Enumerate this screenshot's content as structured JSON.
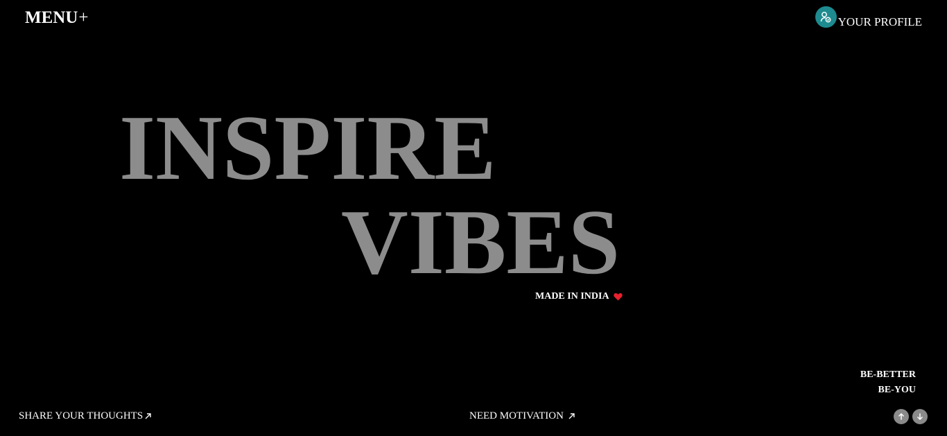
{
  "header": {
    "menu_label": "MENU",
    "menu_plus": "+",
    "profile_label": "YOUR PROFILE"
  },
  "hero": {
    "line1": "INSPIRE",
    "line2": "VIBES",
    "made_in": "MADE IN INDIA"
  },
  "taglines": [
    "BE-BETTER",
    "BE-YOU"
  ],
  "footer": {
    "share_label": "SHARE YOUR THOUGHTS",
    "motivation_label": "NEED MOTIVATION"
  },
  "icons": {
    "profile": "profile-icon",
    "heart": "heart-icon",
    "external": "arrow-up-right-icon",
    "scroll_up": "arrow-up-icon",
    "scroll_down": "arrow-down-icon"
  },
  "colors": {
    "background": "#000000",
    "hero_text": "#8c8c8c",
    "avatar": "#1d8b8f",
    "heart": "#e8202f",
    "scroll_button": "#8a8a8a"
  }
}
